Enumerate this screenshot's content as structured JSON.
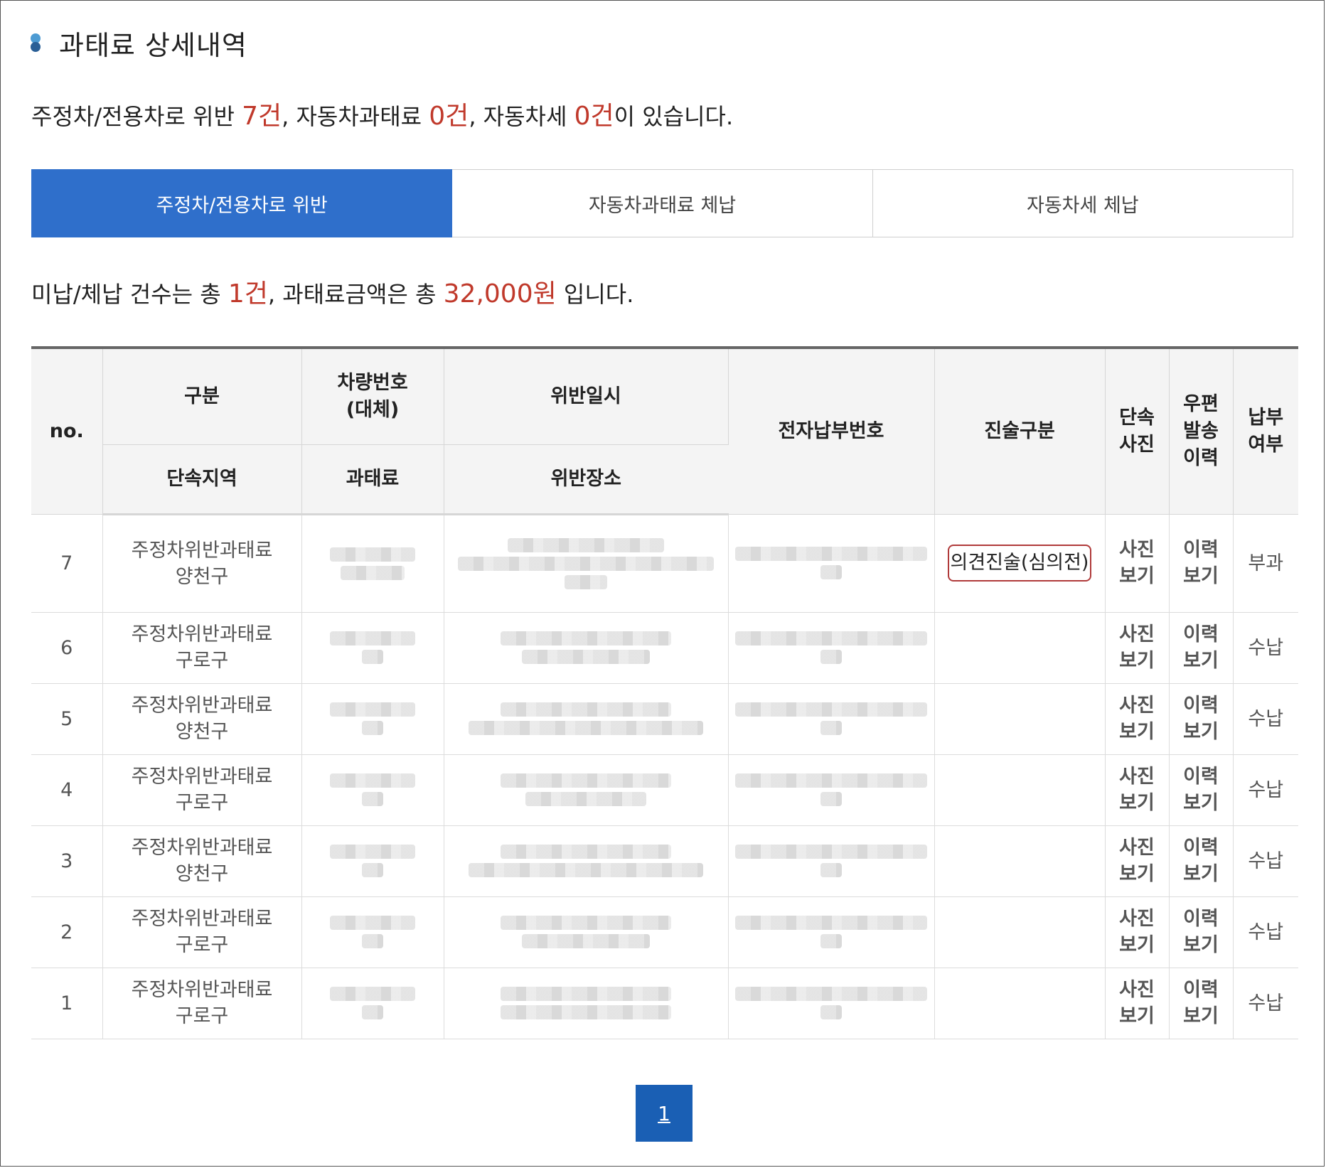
{
  "header": {
    "title": "과태료 상세내역"
  },
  "summary": {
    "part1": "주정차/전용차로 위반 ",
    "count_parking": "7건",
    "part2": ", 자동차과태료 ",
    "count_car_penalty": "0건",
    "part3": ", 자동차세 ",
    "count_car_tax": "0건",
    "part4": "이 있습니다."
  },
  "tabs": [
    {
      "label": "주정차/전용차로 위반",
      "active": true
    },
    {
      "label": "자동차과태료 체납",
      "active": false
    },
    {
      "label": "자동차세 체납",
      "active": false
    }
  ],
  "summary2": {
    "part1": "미납/체납 건수는 총 ",
    "count": "1건",
    "part2": ", 과태료금액은 총 ",
    "amount": "32,000원",
    "part3": " 입니다."
  },
  "table": {
    "headers": {
      "no": "no.",
      "category": "구분",
      "car_number_line1": "차량번호",
      "car_number_line2": "(대체)",
      "violation_datetime": "위반일시",
      "epay_number": "전자납부번호",
      "statement": "진술구분",
      "photo_line1": "단속",
      "photo_line2": "사진",
      "mail_line1": "우편",
      "mail_line2": "발송",
      "mail_line3": "이력",
      "paid_line1": "납부",
      "paid_line2": "여부",
      "region": "단속지역",
      "fine": "과태료",
      "location": "위반장소"
    },
    "rows": [
      {
        "no": "7",
        "category": "주정차위반과태료",
        "region": "양천구",
        "statement": "의견진술(심의전)",
        "photo1": "사진",
        "photo2": "보기",
        "mail1": "이력",
        "mail2": "보기",
        "status": "부과"
      },
      {
        "no": "6",
        "category": "주정차위반과태료",
        "region": "구로구",
        "statement": "",
        "photo1": "사진",
        "photo2": "보기",
        "mail1": "이력",
        "mail2": "보기",
        "status": "수납"
      },
      {
        "no": "5",
        "category": "주정차위반과태료",
        "region": "양천구",
        "statement": "",
        "photo1": "사진",
        "photo2": "보기",
        "mail1": "이력",
        "mail2": "보기",
        "status": "수납"
      },
      {
        "no": "4",
        "category": "주정차위반과태료",
        "region": "구로구",
        "statement": "",
        "photo1": "사진",
        "photo2": "보기",
        "mail1": "이력",
        "mail2": "보기",
        "status": "수납"
      },
      {
        "no": "3",
        "category": "주정차위반과태료",
        "region": "양천구",
        "statement": "",
        "photo1": "사진",
        "photo2": "보기",
        "mail1": "이력",
        "mail2": "보기",
        "status": "수납"
      },
      {
        "no": "2",
        "category": "주정차위반과태료",
        "region": "구로구",
        "statement": "",
        "photo1": "사진",
        "photo2": "보기",
        "mail1": "이력",
        "mail2": "보기",
        "status": "수납"
      },
      {
        "no": "1",
        "category": "주정차위반과태료",
        "region": "구로구",
        "statement": "",
        "photo1": "사진",
        "photo2": "보기",
        "mail1": "이력",
        "mail2": "보기",
        "status": "수납"
      }
    ]
  },
  "pagination": {
    "current": "1"
  }
}
